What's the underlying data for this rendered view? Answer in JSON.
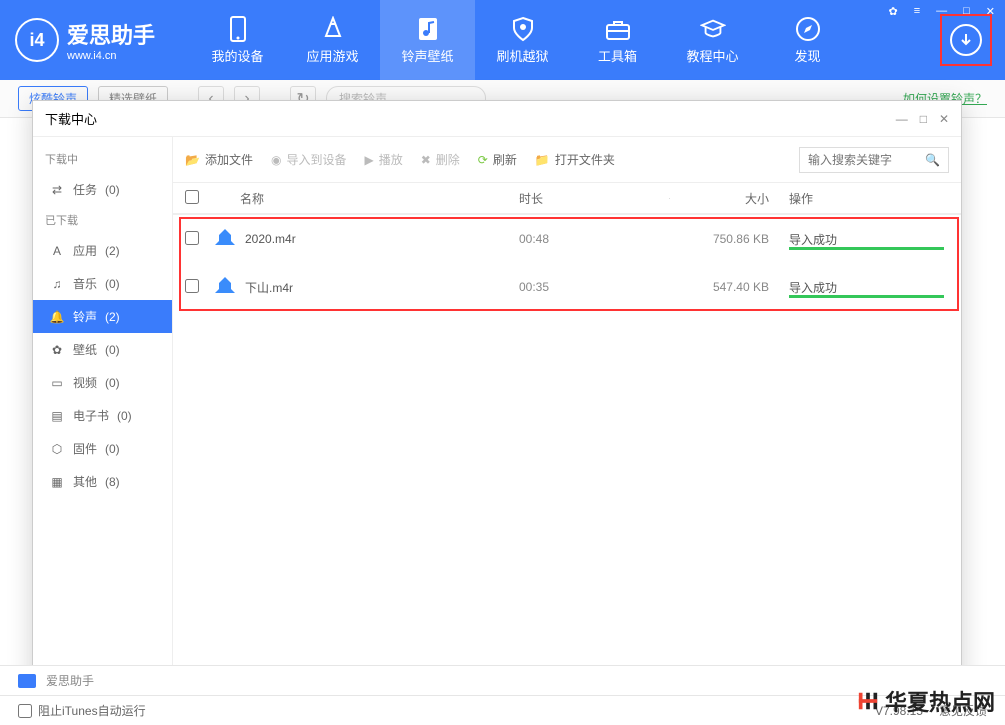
{
  "app": {
    "title": "爱思助手",
    "subtitle": "www.i4.cn"
  },
  "nav": [
    {
      "label": "我的设备"
    },
    {
      "label": "应用游戏"
    },
    {
      "label": "铃声壁纸",
      "active": true
    },
    {
      "label": "刷机越狱"
    },
    {
      "label": "工具箱"
    },
    {
      "label": "教程中心"
    },
    {
      "label": "发现"
    }
  ],
  "nav_icons": [
    "device",
    "apps",
    "ringtone",
    "shield",
    "toolbox",
    "tutorial",
    "discover"
  ],
  "subtoolbar": {
    "tab1": "炫酷铃声",
    "tab2": "精选壁纸",
    "search_placeholder": "搜索铃声",
    "help": "如何设置铃声？"
  },
  "dialog": {
    "title": "下载中心",
    "sidebar": {
      "downloading_title": "下载中",
      "downloading_items": [
        {
          "label": "任务",
          "count": "(0)"
        }
      ],
      "downloaded_title": "已下载",
      "downloaded_items": [
        {
          "label": "应用",
          "count": "(2)"
        },
        {
          "label": "音乐",
          "count": "(0)"
        },
        {
          "label": "铃声",
          "count": "(2)",
          "active": true
        },
        {
          "label": "壁纸",
          "count": "(0)"
        },
        {
          "label": "视频",
          "count": "(0)"
        },
        {
          "label": "电子书",
          "count": "(0)"
        },
        {
          "label": "固件",
          "count": "(0)"
        },
        {
          "label": "其他",
          "count": "(8)"
        }
      ]
    },
    "toolbar": {
      "add_file": "添加文件",
      "import": "导入到设备",
      "play": "播放",
      "delete": "删除",
      "refresh": "刷新",
      "open_folder": "打开文件夹",
      "search_placeholder": "输入搜索关键字"
    },
    "columns": {
      "name": "名称",
      "duration": "时长",
      "size": "大小",
      "action": "操作"
    },
    "files": [
      {
        "name": "2020.m4r",
        "duration": "00:48",
        "size": "750.86 KB",
        "status": "导入成功"
      },
      {
        "name": "下山.m4r",
        "duration": "00:35",
        "size": "547.40 KB",
        "status": "导入成功"
      }
    ]
  },
  "footer": {
    "app_name": "爱思助手",
    "block_itunes": "阻止iTunes自动运行",
    "version": "V7.98.15",
    "feedback": "意见反馈"
  },
  "watermark": "华夏热点网"
}
